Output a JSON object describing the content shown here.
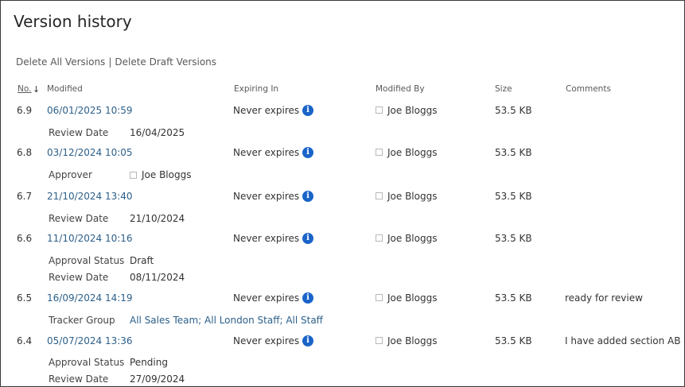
{
  "page": {
    "title": "Version history",
    "actions": {
      "delete_all": "Delete All Versions",
      "separator": "|",
      "delete_draft": "Delete Draft Versions"
    }
  },
  "columns": {
    "no": "No.",
    "sort_indicator": "↓",
    "modified": "Modified",
    "expiring_in": "Expiring In",
    "modified_by": "Modified By",
    "size": "Size",
    "comments": "Comments"
  },
  "info_icon_glyph": "i",
  "versions": [
    {
      "no": "6.9",
      "modified": "06/01/2025 10:59",
      "expiring": "Never expires",
      "modified_by": "Joe Bloggs",
      "size": "53.5 KB",
      "comment": "",
      "meta": [
        {
          "label": "Review Date",
          "value": "16/04/2025"
        }
      ]
    },
    {
      "no": "6.8",
      "modified": "03/12/2024 10:05",
      "expiring": "Never expires",
      "modified_by": "Joe Bloggs",
      "size": "53.5 KB",
      "comment": "",
      "meta": [
        {
          "label": "Approver",
          "value": "Joe Bloggs"
        }
      ]
    },
    {
      "no": "6.7",
      "modified": "21/10/2024 13:40",
      "expiring": "Never expires",
      "modified_by": "Joe Bloggs",
      "size": "53.5 KB",
      "comment": "",
      "meta": [
        {
          "label": "Review Date",
          "value": "21/10/2024"
        }
      ]
    },
    {
      "no": "6.6",
      "modified": "11/10/2024 10:16",
      "expiring": "Never expires",
      "modified_by": "Joe Bloggs",
      "size": "53.5 KB",
      "comment": "",
      "meta": [
        {
          "label": "Approval Status",
          "value": "Draft"
        },
        {
          "label": "Review Date",
          "value": "08/11/2024"
        }
      ]
    },
    {
      "no": "6.5",
      "modified": "16/09/2024 14:19",
      "expiring": "Never expires",
      "modified_by": "Joe Bloggs",
      "size": "53.5 KB",
      "comment": "ready for review",
      "meta": [
        {
          "label": "Tracker Group",
          "value": "All Sales Team; All London Staff; All Staff"
        }
      ]
    },
    {
      "no": "6.4",
      "modified": "05/07/2024 13:36",
      "expiring": "Never expires",
      "modified_by": "Joe Bloggs",
      "size": "53.5 KB",
      "comment": "I have added section AB",
      "meta": [
        {
          "label": "Approval Status",
          "value": "Pending"
        },
        {
          "label": "Review Date",
          "value": "27/09/2024"
        }
      ]
    }
  ],
  "colors": {
    "link": "#2c5f8a",
    "info_icon": "#1a64c8",
    "text": "#333333",
    "muted": "#595959"
  }
}
